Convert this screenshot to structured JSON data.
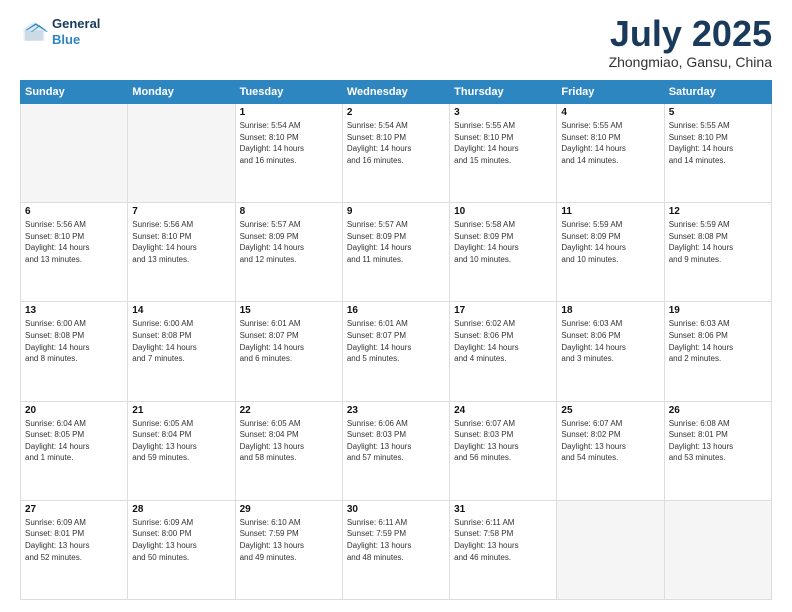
{
  "logo": {
    "line1": "General",
    "line2": "Blue"
  },
  "header": {
    "title": "July 2025",
    "subtitle": "Zhongmiao, Gansu, China"
  },
  "weekdays": [
    "Sunday",
    "Monday",
    "Tuesday",
    "Wednesday",
    "Thursday",
    "Friday",
    "Saturday"
  ],
  "weeks": [
    [
      {
        "day": "",
        "info": ""
      },
      {
        "day": "",
        "info": ""
      },
      {
        "day": "1",
        "info": "Sunrise: 5:54 AM\nSunset: 8:10 PM\nDaylight: 14 hours\nand 16 minutes."
      },
      {
        "day": "2",
        "info": "Sunrise: 5:54 AM\nSunset: 8:10 PM\nDaylight: 14 hours\nand 16 minutes."
      },
      {
        "day": "3",
        "info": "Sunrise: 5:55 AM\nSunset: 8:10 PM\nDaylight: 14 hours\nand 15 minutes."
      },
      {
        "day": "4",
        "info": "Sunrise: 5:55 AM\nSunset: 8:10 PM\nDaylight: 14 hours\nand 14 minutes."
      },
      {
        "day": "5",
        "info": "Sunrise: 5:55 AM\nSunset: 8:10 PM\nDaylight: 14 hours\nand 14 minutes."
      }
    ],
    [
      {
        "day": "6",
        "info": "Sunrise: 5:56 AM\nSunset: 8:10 PM\nDaylight: 14 hours\nand 13 minutes."
      },
      {
        "day": "7",
        "info": "Sunrise: 5:56 AM\nSunset: 8:10 PM\nDaylight: 14 hours\nand 13 minutes."
      },
      {
        "day": "8",
        "info": "Sunrise: 5:57 AM\nSunset: 8:09 PM\nDaylight: 14 hours\nand 12 minutes."
      },
      {
        "day": "9",
        "info": "Sunrise: 5:57 AM\nSunset: 8:09 PM\nDaylight: 14 hours\nand 11 minutes."
      },
      {
        "day": "10",
        "info": "Sunrise: 5:58 AM\nSunset: 8:09 PM\nDaylight: 14 hours\nand 10 minutes."
      },
      {
        "day": "11",
        "info": "Sunrise: 5:59 AM\nSunset: 8:09 PM\nDaylight: 14 hours\nand 10 minutes."
      },
      {
        "day": "12",
        "info": "Sunrise: 5:59 AM\nSunset: 8:08 PM\nDaylight: 14 hours\nand 9 minutes."
      }
    ],
    [
      {
        "day": "13",
        "info": "Sunrise: 6:00 AM\nSunset: 8:08 PM\nDaylight: 14 hours\nand 8 minutes."
      },
      {
        "day": "14",
        "info": "Sunrise: 6:00 AM\nSunset: 8:08 PM\nDaylight: 14 hours\nand 7 minutes."
      },
      {
        "day": "15",
        "info": "Sunrise: 6:01 AM\nSunset: 8:07 PM\nDaylight: 14 hours\nand 6 minutes."
      },
      {
        "day": "16",
        "info": "Sunrise: 6:01 AM\nSunset: 8:07 PM\nDaylight: 14 hours\nand 5 minutes."
      },
      {
        "day": "17",
        "info": "Sunrise: 6:02 AM\nSunset: 8:06 PM\nDaylight: 14 hours\nand 4 minutes."
      },
      {
        "day": "18",
        "info": "Sunrise: 6:03 AM\nSunset: 8:06 PM\nDaylight: 14 hours\nand 3 minutes."
      },
      {
        "day": "19",
        "info": "Sunrise: 6:03 AM\nSunset: 8:06 PM\nDaylight: 14 hours\nand 2 minutes."
      }
    ],
    [
      {
        "day": "20",
        "info": "Sunrise: 6:04 AM\nSunset: 8:05 PM\nDaylight: 14 hours\nand 1 minute."
      },
      {
        "day": "21",
        "info": "Sunrise: 6:05 AM\nSunset: 8:04 PM\nDaylight: 13 hours\nand 59 minutes."
      },
      {
        "day": "22",
        "info": "Sunrise: 6:05 AM\nSunset: 8:04 PM\nDaylight: 13 hours\nand 58 minutes."
      },
      {
        "day": "23",
        "info": "Sunrise: 6:06 AM\nSunset: 8:03 PM\nDaylight: 13 hours\nand 57 minutes."
      },
      {
        "day": "24",
        "info": "Sunrise: 6:07 AM\nSunset: 8:03 PM\nDaylight: 13 hours\nand 56 minutes."
      },
      {
        "day": "25",
        "info": "Sunrise: 6:07 AM\nSunset: 8:02 PM\nDaylight: 13 hours\nand 54 minutes."
      },
      {
        "day": "26",
        "info": "Sunrise: 6:08 AM\nSunset: 8:01 PM\nDaylight: 13 hours\nand 53 minutes."
      }
    ],
    [
      {
        "day": "27",
        "info": "Sunrise: 6:09 AM\nSunset: 8:01 PM\nDaylight: 13 hours\nand 52 minutes."
      },
      {
        "day": "28",
        "info": "Sunrise: 6:09 AM\nSunset: 8:00 PM\nDaylight: 13 hours\nand 50 minutes."
      },
      {
        "day": "29",
        "info": "Sunrise: 6:10 AM\nSunset: 7:59 PM\nDaylight: 13 hours\nand 49 minutes."
      },
      {
        "day": "30",
        "info": "Sunrise: 6:11 AM\nSunset: 7:59 PM\nDaylight: 13 hours\nand 48 minutes."
      },
      {
        "day": "31",
        "info": "Sunrise: 6:11 AM\nSunset: 7:58 PM\nDaylight: 13 hours\nand 46 minutes."
      },
      {
        "day": "",
        "info": ""
      },
      {
        "day": "",
        "info": ""
      }
    ]
  ]
}
